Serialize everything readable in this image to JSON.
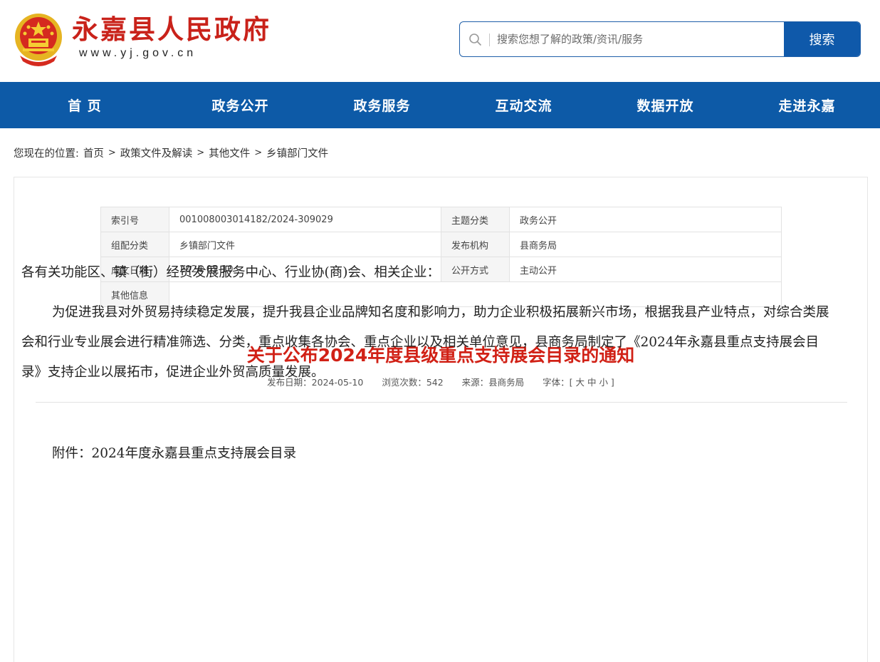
{
  "header": {
    "site_title": "永嘉县人民政府",
    "site_url": "www.yj.gov.cn",
    "emblem_icon": "national-emblem-icon",
    "search": {
      "placeholder": "搜索您想了解的政策/资讯/服务",
      "value": "",
      "button_label": "搜索"
    },
    "accent_color": "#0d5aa7",
    "brand_red": "#c9221a"
  },
  "nav": {
    "items": [
      {
        "label": "首 页"
      },
      {
        "label": "政务公开"
      },
      {
        "label": "政务服务"
      },
      {
        "label": "互动交流"
      },
      {
        "label": "数据开放"
      },
      {
        "label": "走进永嘉"
      }
    ]
  },
  "breadcrumb": {
    "prefix": "您现在的位置:",
    "items": [
      "首页",
      "政策文件及解读",
      "其他文件",
      "乡镇部门文件"
    ],
    "separator": ">"
  },
  "meta": {
    "rows": [
      {
        "k1": "索引号",
        "v1": "001008003014182/2024-309029",
        "k2": "主题分类",
        "v2": "政务公开"
      },
      {
        "k1": "组配分类",
        "v1": "乡镇部门文件",
        "k2": "发布机构",
        "v2": "县商务局"
      },
      {
        "k1": "成文日期",
        "v1": "2024-05-10",
        "k2": "公开方式",
        "v2": "主动公开"
      },
      {
        "k1": "其他信息",
        "v1": ""
      }
    ]
  },
  "article": {
    "title": "关于公布2024年度县级重点支持展会目录的通知",
    "info": {
      "publish_date": "发布日期：2024-05-10",
      "views": "浏览次数：542",
      "source": "来源：县商务局",
      "font_size": "字体：[ 大 中 小 ]"
    },
    "greeting": "各有关功能区、镇（街）经贸发展服务中心、行业协(商)会、相关企业：",
    "body": "为促进我县对外贸易持续稳定发展，提升我县企业品牌知名度和影响力，助力企业积极拓展新兴市场，根据我县产业特点，对综合类展会和行业专业展会进行精准筛选、分类，重点收集各协会、重点企业以及相关单位意见，县商务局制定了《2024年永嘉县重点支持展会目录》支持企业以展拓市，促进企业外贸高质量发展。",
    "attachment": "附件：2024年度永嘉县重点支持展会目录"
  }
}
